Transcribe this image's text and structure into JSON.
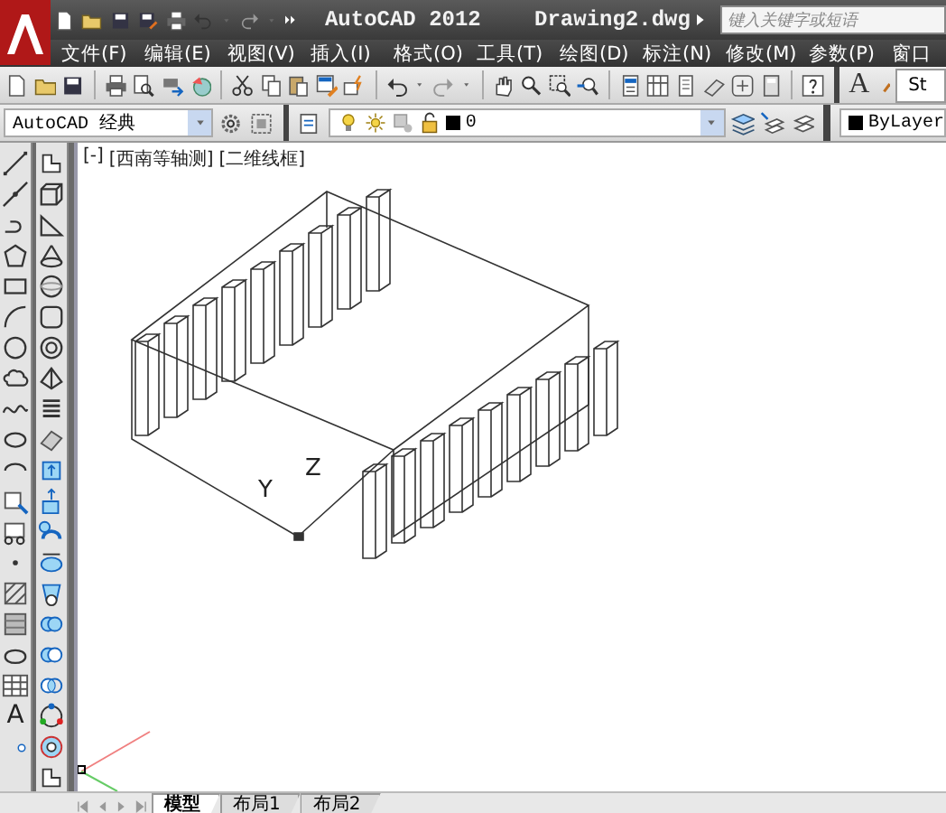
{
  "title_bar": {
    "app_title": "AutoCAD 2012",
    "file_name": "Drawing2.dwg",
    "search": {
      "placeholder": "键入关键字或短语"
    }
  },
  "menu": [
    {
      "label": "文件(F)"
    },
    {
      "label": "编辑(E)"
    },
    {
      "label": "视图(V)"
    },
    {
      "label": "插入(I)"
    },
    {
      "label": "格式(O)"
    },
    {
      "label": "工具(T)"
    },
    {
      "label": "绘图(D)"
    },
    {
      "label": "标注(N)"
    },
    {
      "label": "修改(M)"
    },
    {
      "label": "参数(P)"
    },
    {
      "label": "窗口"
    }
  ],
  "style_toolbar": {
    "glyph": "A",
    "style_value": "St"
  },
  "workspace": {
    "value": "AutoCAD 经典"
  },
  "layer": {
    "name": "0"
  },
  "color_control": {
    "value": "ByLayer"
  },
  "draw_tools": {
    "text_glyph": "A"
  },
  "viewport": {
    "controls": [
      "[-]",
      "[西南等轴测]",
      "[二维线框]"
    ],
    "axis_labels": [
      "Y",
      "Z"
    ]
  },
  "layout_tabs": [
    {
      "label": "模型",
      "selected": true
    },
    {
      "label": "布局1",
      "selected": false
    },
    {
      "label": "布局2",
      "selected": false
    }
  ]
}
